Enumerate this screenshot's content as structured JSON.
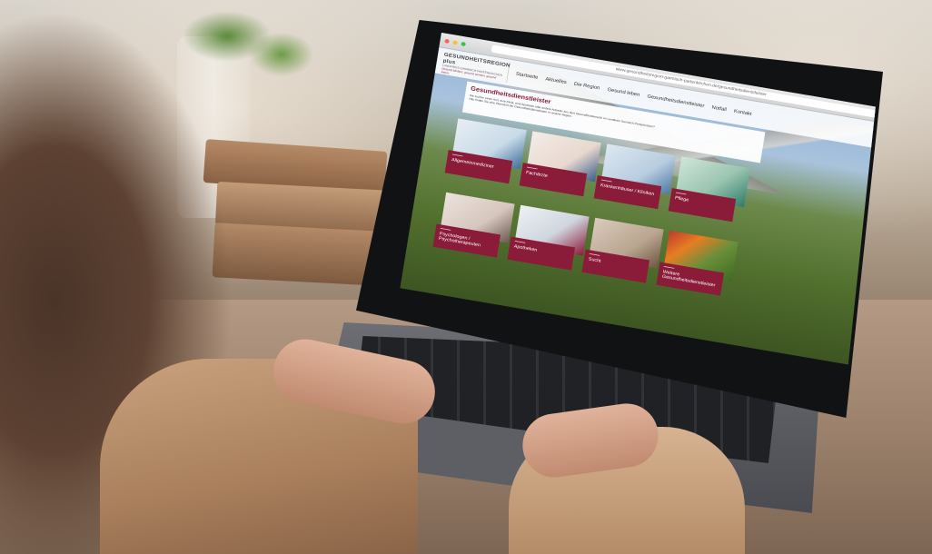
{
  "browser": {
    "url": "www.gesundheitsregion-garmisch-partenkirchen.de/gesundheitsdienstleister"
  },
  "site": {
    "logo": {
      "line1": "GESUNDHEITSREGION plus",
      "line2": "LANDKREIS GARMISCH-PARTENKIRCHEN",
      "tagline": "Gesund bleiben, gesund werden, gesund leben."
    },
    "nav": [
      "Startseite",
      "Aktuelles",
      "Die Region",
      "Gesund leben",
      "Gesundheitsdienstleister",
      "Notfall",
      "Kontakt"
    ],
    "panel": {
      "title": "Gesundheitsdienstleister",
      "text1": "Sie suchen einen Arzt, eine Klinik, eine Apotheke oder andere Anbieter aus dem Gesundheitsbereich im Landkreis Garmisch-Partenkirchen?",
      "text2": "Hier finden Sie eine Übersicht der Gesundheitsdienstleister in unserer Region."
    },
    "tiles": [
      {
        "label": "Allgemeinmediziner",
        "color": "#c9dbe8"
      },
      {
        "label": "Fachärzte",
        "color": "#e8d8cf"
      },
      {
        "label": "Krankenhäuser / Kliniken",
        "color": "#b8cde0"
      },
      {
        "label": "Pflege",
        "color": "#9bc5b0"
      },
      {
        "label": "Psychologen / Psychotherapeuten",
        "color": "#d6c6bd"
      },
      {
        "label": "Apotheken",
        "color": "#cfd6de"
      },
      {
        "label": "Sucht",
        "color": "#b9a58f"
      },
      {
        "label": "Weitere Gesundheitsdienstleister",
        "color": "#6a8f3a"
      }
    ]
  }
}
